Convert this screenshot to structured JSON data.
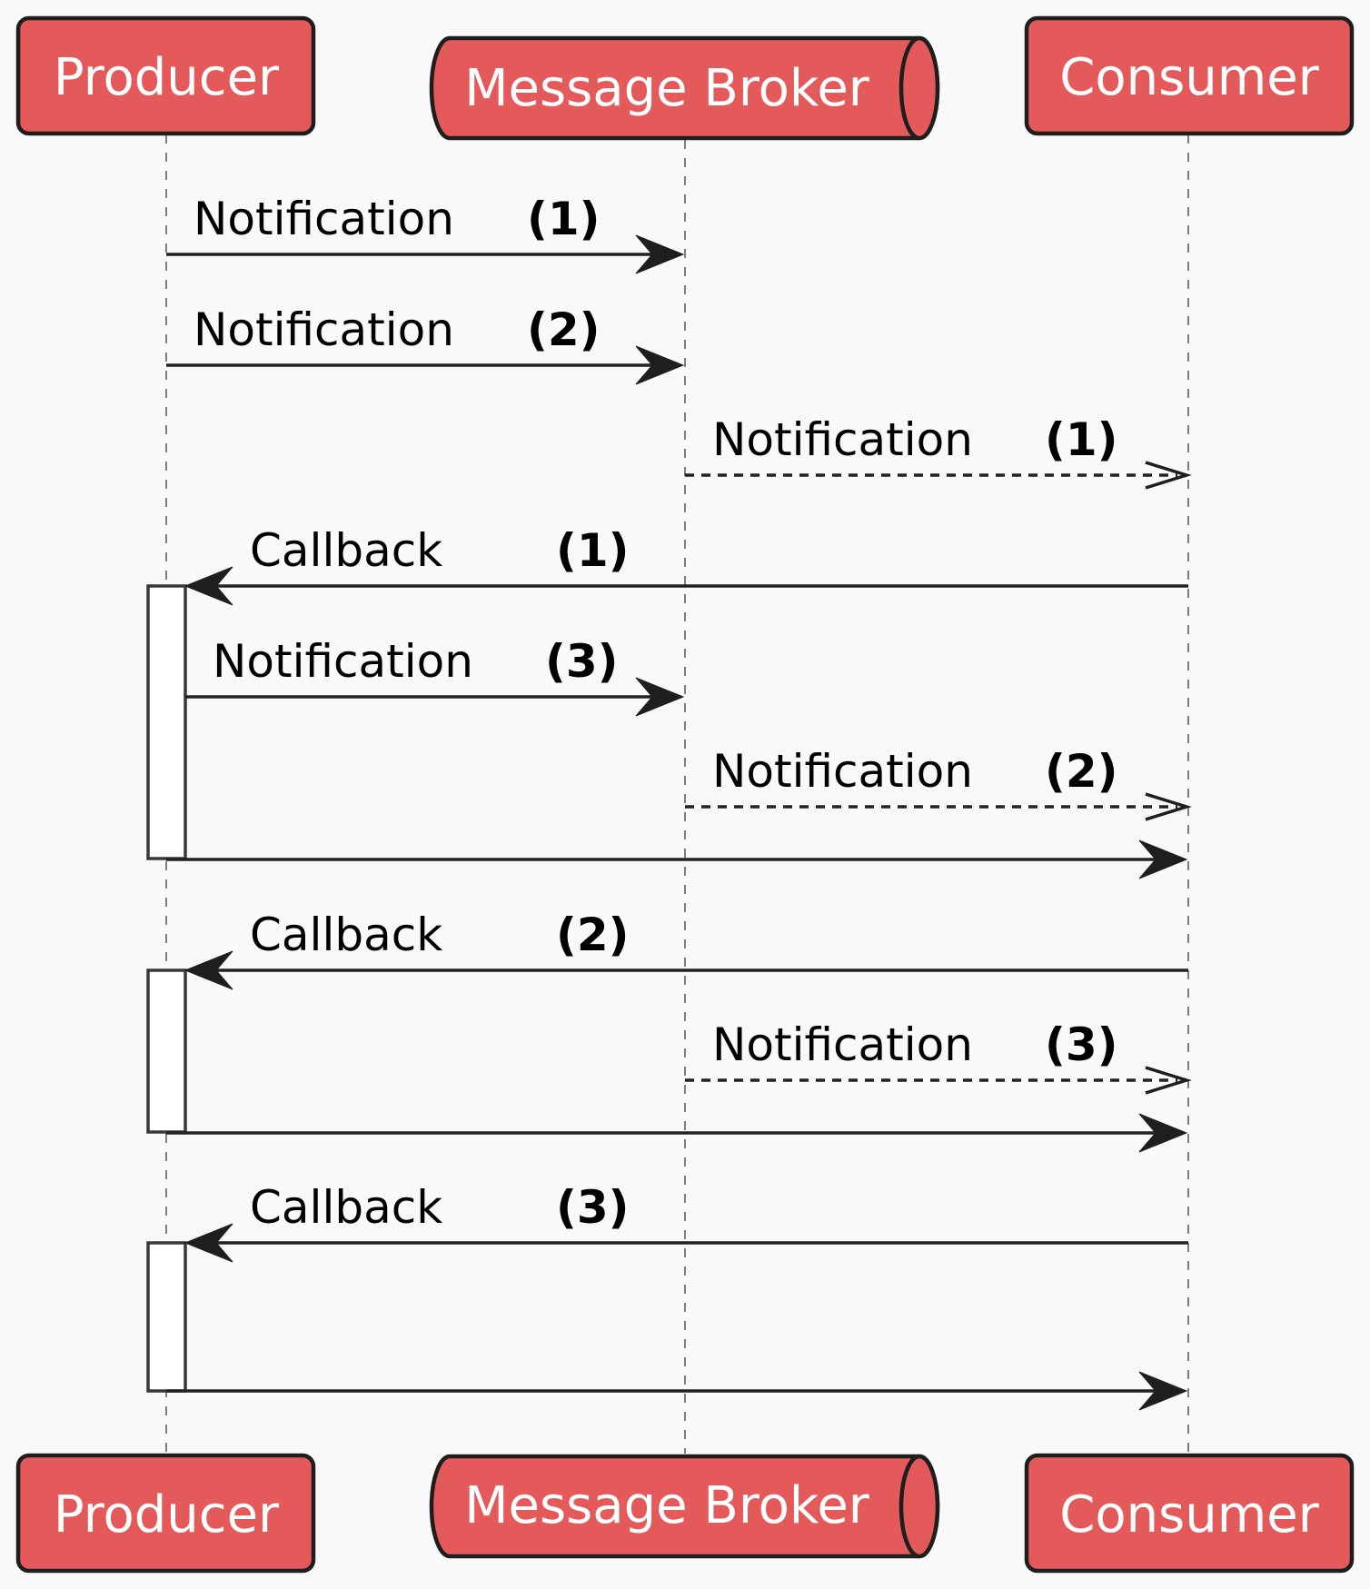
{
  "diagram": {
    "type": "sequence",
    "colors": {
      "background": "#f9f9f9",
      "participant_fill": "#e45959",
      "participant_border": "#1e1e1e",
      "participant_text": "#ffffff",
      "arrow": "#1e1e1e",
      "activation_fill": "#ffffff"
    },
    "participants": [
      {
        "id": "producer",
        "label": "Producer",
        "shape": "box"
      },
      {
        "id": "broker",
        "label": "Message Broker",
        "shape": "queue"
      },
      {
        "id": "consumer",
        "label": "Consumer",
        "shape": "box"
      }
    ],
    "messages": [
      {
        "from": "producer",
        "to": "broker",
        "text": "Notification",
        "number": "(1)",
        "style": "solid"
      },
      {
        "from": "producer",
        "to": "broker",
        "text": "Notification",
        "number": "(2)",
        "style": "solid"
      },
      {
        "from": "broker",
        "to": "consumer",
        "text": "Notification",
        "number": "(1)",
        "style": "dashed-open"
      },
      {
        "from": "consumer",
        "to": "producer",
        "text": "Callback",
        "number": "(1)",
        "style": "solid",
        "activate": "producer"
      },
      {
        "from": "producer",
        "to": "broker",
        "text": "Notification",
        "number": "(3)",
        "style": "solid"
      },
      {
        "from": "broker",
        "to": "consumer",
        "text": "Notification",
        "number": "(2)",
        "style": "dashed-open"
      },
      {
        "from": "producer",
        "to": "consumer",
        "text": "",
        "number": "",
        "style": "solid",
        "deactivate": "producer"
      },
      {
        "from": "consumer",
        "to": "producer",
        "text": "Callback",
        "number": "(2)",
        "style": "solid",
        "activate": "producer"
      },
      {
        "from": "broker",
        "to": "consumer",
        "text": "Notification",
        "number": "(3)",
        "style": "dashed-open"
      },
      {
        "from": "producer",
        "to": "consumer",
        "text": "",
        "number": "",
        "style": "solid",
        "deactivate": "producer"
      },
      {
        "from": "consumer",
        "to": "producer",
        "text": "Callback",
        "number": "(3)",
        "style": "solid",
        "activate": "producer"
      },
      {
        "from": "producer",
        "to": "consumer",
        "text": "",
        "number": "",
        "style": "solid",
        "deactivate": "producer"
      }
    ]
  }
}
